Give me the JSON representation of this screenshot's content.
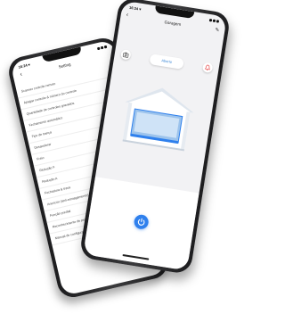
{
  "back_phone": {
    "status_time": "16:24 ▾",
    "title": "Setting",
    "items": [
      {
        "label": "Scanner controle remoto",
        "control": "chevron"
      },
      {
        "label": "Apagar controle & número do controle",
        "control": "chevron"
      },
      {
        "label": "Quantidade de controles gravados",
        "control": "chevron"
      },
      {
        "label": "Fechamento automático",
        "control": "chevron"
      },
      {
        "label": "Tipo de trança",
        "control": "chevron"
      },
      {
        "label": "Desacelerar",
        "control": "slider",
        "value": 0.3
      },
      {
        "label": "Freio",
        "control": "slider",
        "value": 0.4
      },
      {
        "label": "Redução F",
        "control": "slider",
        "value": 0.5
      },
      {
        "label": "Redução A",
        "control": "slider",
        "value": 0.35
      },
      {
        "label": "Fechadura & trava",
        "control": "toggle"
      },
      {
        "label": "Anuncior (anti-esmagamento)",
        "control": "chevron"
      },
      {
        "label": "Função predial",
        "control": "chevron"
      },
      {
        "label": "Reconhecimento de percurso",
        "control": "chevron"
      },
      {
        "label": "Manual de configuração",
        "control": "chevron"
      }
    ],
    "chevron_glyph": "›",
    "back_glyph": "‹"
  },
  "front_phone": {
    "status_time": "16:24 ▾",
    "title": "Garagem",
    "back_glyph": "‹",
    "edit_glyph": "✎",
    "status_label": "Aberto",
    "accent_color": "#2f80ed",
    "alert_color": "#e84a4a"
  }
}
